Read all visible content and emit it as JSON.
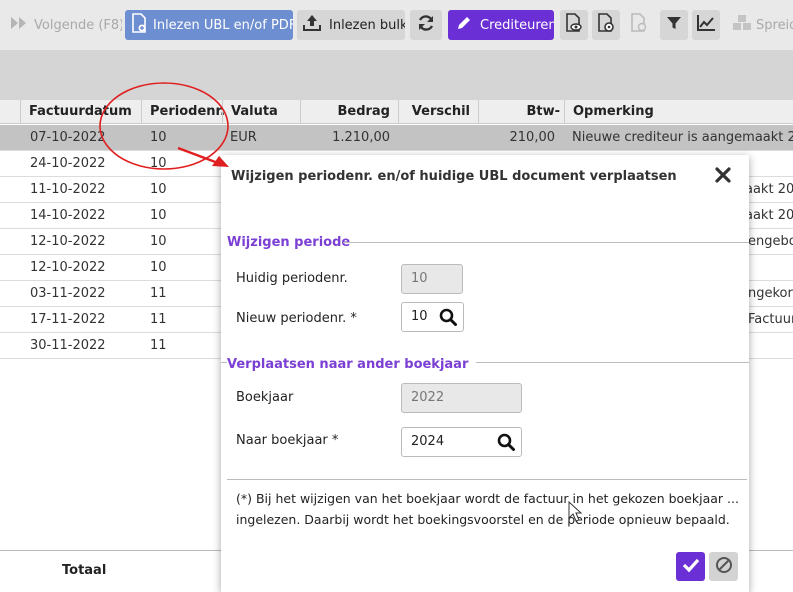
{
  "toolbar": {
    "volgende_label": "Volgende (F8)",
    "inlezen_ubl_label": "Inlezen UBL en/of PDF",
    "inlezen_bulk_label": "Inlezen bulk",
    "crediteuren_label": "Crediteuren",
    "spreid_label": "Spreid",
    "accent_color": "#6b2fd6",
    "ubl_color": "#6d8ed0"
  },
  "grid": {
    "columns": [
      "Factuurdatum",
      "Periodenr.",
      "Valuta",
      "Bedrag",
      "Verschil",
      "Btw-bedrag",
      "Opmerking"
    ],
    "rows": [
      {
        "datum": "07-10-2022",
        "periode": "10",
        "valuta": "EUR",
        "bedrag": "1.210,00",
        "btw": "210,00",
        "opmerking": "Nieuwe crediteur is aangemaakt 20"
      },
      {
        "datum": "24-10-2022",
        "periode": "10",
        "valuta": "",
        "bedrag": "",
        "btw": "",
        "opmerking": ""
      },
      {
        "datum": "11-10-2022",
        "periode": "10",
        "valuta": "",
        "bedrag": "",
        "btw": "",
        "opmerking": "aakt 20"
      },
      {
        "datum": "14-10-2022",
        "periode": "10",
        "valuta": "",
        "bedrag": "",
        "btw": "",
        "opmerking": "aakt 20"
      },
      {
        "datum": "12-10-2022",
        "periode": "10",
        "valuta": "",
        "bedrag": "",
        "btw": "",
        "opmerking": "engebo"
      },
      {
        "datum": "12-10-2022",
        "periode": "10",
        "valuta": "",
        "bedrag": "",
        "btw": "",
        "opmerking": ""
      },
      {
        "datum": "03-11-2022",
        "periode": "11",
        "valuta": "",
        "bedrag": "",
        "btw": "",
        "opmerking": "ngekort"
      },
      {
        "datum": "17-11-2022",
        "periode": "11",
        "valuta": "",
        "bedrag": "",
        "btw": "",
        "opmerking": "Factuur"
      },
      {
        "datum": "30-11-2022",
        "periode": "11",
        "valuta": "",
        "bedrag": "",
        "btw": "",
        "opmerking": ""
      }
    ],
    "total_label": "Totaal"
  },
  "modal": {
    "title": "Wijzigen periodenr. en/of huidige UBL document verplaatsen",
    "section_periode": "Wijzigen periode",
    "huidig_label": "Huidig periodenr.",
    "huidig_value": "10",
    "nieuw_label": "Nieuw periodenr. *",
    "nieuw_value": "10",
    "section_boekjaar": "Verplaatsen naar ander boekjaar",
    "boekjaar_label": "Boekjaar",
    "boekjaar_value": "2022",
    "naar_label": "Naar boekjaar *",
    "naar_value": "2024",
    "note_line1": "(*) Bij het wijzigen van het boekjaar wordt de factuur in het gekozen boekjaar ...",
    "note_line2": "ingelezen. Daarbij wordt het boekingsvoorstel en de periode opnieuw bepaald.",
    "section_color": "#7b3fd4"
  }
}
